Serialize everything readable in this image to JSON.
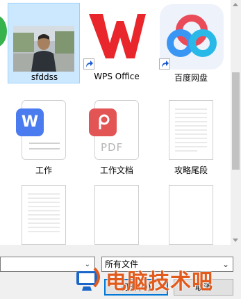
{
  "files": [
    {
      "name": "sfddss",
      "type": "image",
      "selected": true
    },
    {
      "name": "WPS Office",
      "type": "shortcut-wps"
    },
    {
      "name": "百度网盘",
      "type": "shortcut-baidu"
    },
    {
      "name": "工作",
      "type": "word-doc"
    },
    {
      "name": "工作文档",
      "type": "pdf-doc"
    },
    {
      "name": "攻略尾段",
      "type": "text-doc"
    },
    {
      "name": "",
      "type": "text-doc"
    },
    {
      "name": "",
      "type": "blank-doc"
    },
    {
      "name": "",
      "type": "blank-doc"
    }
  ],
  "icons": {
    "word_letter": "W",
    "pdf_label": "PDF"
  },
  "footer": {
    "filename_value": "",
    "filetype_value": "所有文件",
    "open_label": "打开(O)",
    "cancel_label": "取消"
  },
  "watermark": {
    "text": "电脑技术吧"
  },
  "colors": {
    "selection": "#cce8ff",
    "wps_red": "#e8262c",
    "baidu_blue": "#3a96f3",
    "word_blue": "#4a7cf0",
    "pdf_red": "#e35454",
    "watermark": "#e25a1c"
  }
}
